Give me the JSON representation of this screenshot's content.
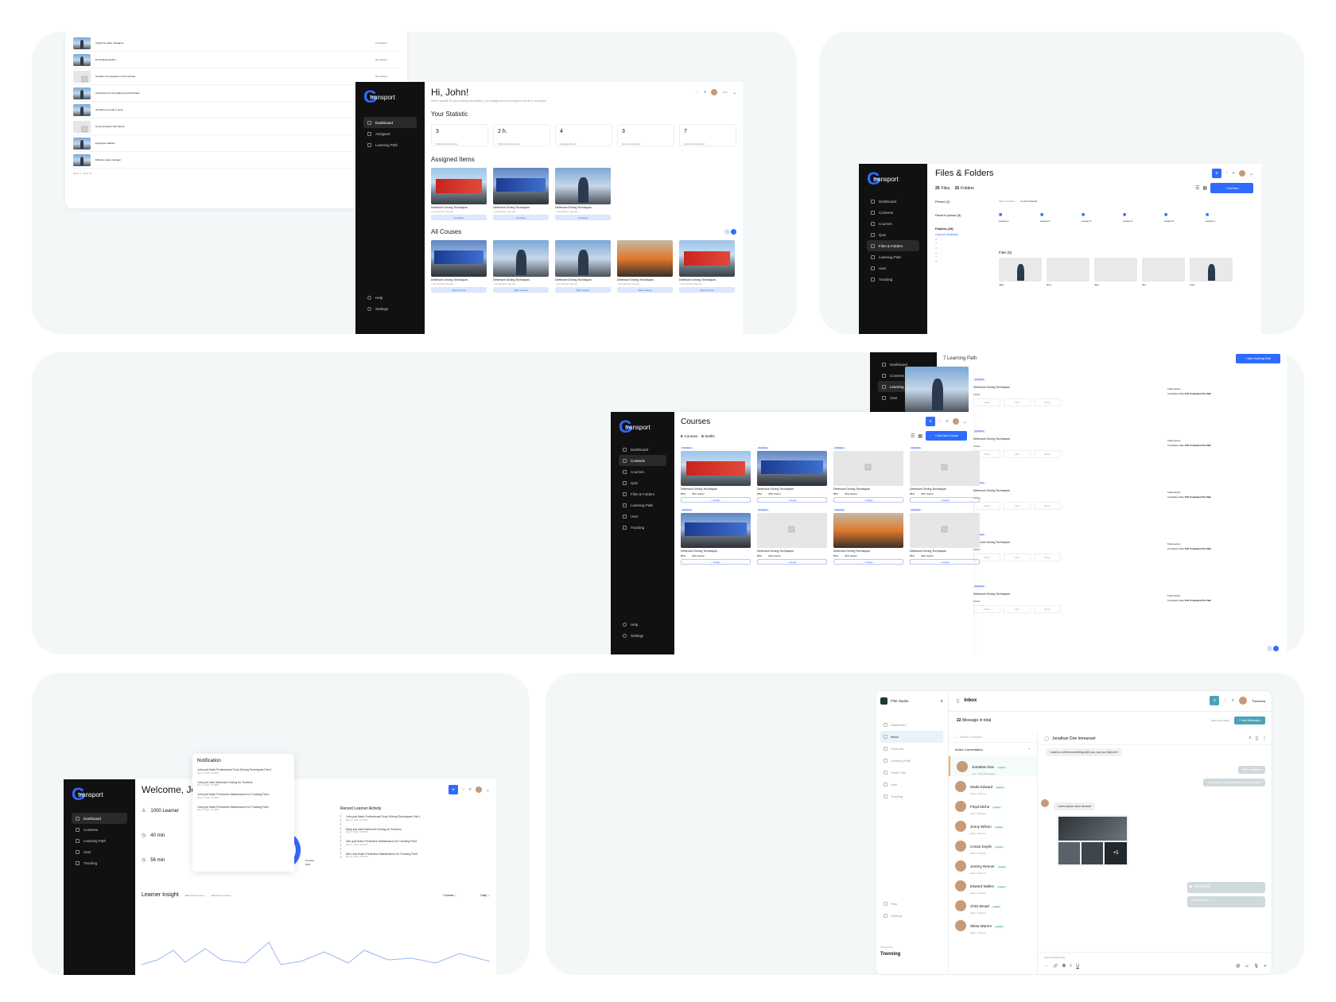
{
  "panel1": {
    "list_rows": [
      {
        "title": "Impact for sales managers",
        "status": "Completed"
      },
      {
        "title": "Dominating leaders",
        "status": "Not started"
      },
      {
        "title": "Creation of a signature in the contract",
        "status": "Not started"
      },
      {
        "title": "Instructions for the platforms administrator",
        "status": "Completed"
      },
      {
        "title": "IP platforms youth in work",
        "status": "Not started"
      },
      {
        "title": "Communication with clients",
        "status": "Not started"
      },
      {
        "title": "Employee platform",
        "status": "Completed"
      },
      {
        "title": "Effective sales manager",
        "status": "Completed"
      }
    ],
    "pager": "Show 1 - 10 in 16",
    "sidebar": {
      "brand": "transport",
      "items": [
        "Dashboard",
        "Assigned",
        "Learning Path"
      ],
      "bottom": [
        "Help",
        "Settings"
      ]
    },
    "greeting": "Hi, John!",
    "greeting_sub": "Here's update for your training information, your assignment and progress are all in one place",
    "stat_title": "Your Statistic",
    "stats": [
      {
        "value": "3",
        "label": "Total Learning items"
      },
      {
        "value": "2 h.",
        "label": "Total Learning items"
      },
      {
        "value": "4",
        "label": "Average Result"
      },
      {
        "value": "3",
        "label": "Items Completed"
      },
      {
        "value": "7",
        "label": "Quizzes Completed"
      }
    ],
    "assigned_title": "Assigned Items",
    "assigned": [
      {
        "title": "Defensive Driving Techniques",
        "meta": "• Last watched 1 day ago",
        "button": "Continue"
      },
      {
        "title": "Defensive Driving Techniques",
        "meta": "• Last watched 1 day ago",
        "button": "Continue"
      },
      {
        "title": "Defensive Driving Techniques",
        "meta": "• Last watched 1 day ago",
        "button": "Continue"
      }
    ],
    "all_title": "All Couses",
    "all": [
      {
        "title": "Defensive Driving Techniques",
        "meta": "• Last watched 1 day ago",
        "button": "Start Course"
      },
      {
        "title": "Defensive Driving Techniques",
        "meta": "• Last watched 1 day ago",
        "button": "Start Course"
      },
      {
        "title": "Defensive Driving Techniques",
        "meta": "• Last watched 1 day ago",
        "button": "Start Course"
      },
      {
        "title": "Defensive Driving Techniques",
        "meta": "• Last watched 1 day ago",
        "button": "Start Course"
      },
      {
        "title": "Defensive Driving Techniques",
        "meta": "• Last watched 1 day ago",
        "button": "Start Course"
      }
    ],
    "user": "John"
  },
  "panel2": {
    "sidebar": {
      "brand": "transport",
      "items": [
        "Dashboard",
        "Contents",
        "Courses",
        "Quiz",
        "Files & Folders",
        "Learning Path",
        "User",
        "Tracking"
      ]
    },
    "title": "Files & Folders",
    "files_count": "20",
    "files_label": "Files,",
    "folders_count": "15",
    "folders_label": "Folders",
    "add_button": "+ Add New",
    "pinned": "Pinned (2)",
    "recent": "Recent Upload (8)",
    "folders_title": "Folders (15)",
    "course_material": "Course material",
    "breadcrumb_a": "Files & Folders",
    "breadcrumb_b": "Course Material",
    "lessons": [
      "Lesson 1",
      "Lesson 2",
      "Lesson 3",
      "Lesson 4",
      "Lesson 5",
      "Lesson 1"
    ],
    "files_section": "Files (5)",
    "files": [
      "Jayk",
      "shot",
      "Jaut",
      "doc",
      "xnyk"
    ]
  },
  "panel3": {
    "sidebar": {
      "brand": "transport",
      "items": [
        "Dashboard",
        "Contents",
        "Courses",
        "Quiz",
        "Files & Folders",
        "Learning Path",
        "User",
        "Tracking"
      ],
      "bottom": [
        "Help",
        "Settings"
      ]
    },
    "title": "Courses",
    "courses_count": "6",
    "courses_label": "Courses",
    "drafts_count": "6",
    "drafts_label": "Drafts",
    "add_button": "+ Add New Course",
    "card_title": "Defensive Driving Techniques",
    "status_published": "Published",
    "assign": "+ Assign",
    "completion": "85%",
    "useful": "45% Useful",
    "lp_sidebar": [
      "Dashboard",
      "Contents",
      "Learning Path",
      "User"
    ],
    "lp_title": "7 Learning Path",
    "lp_add": "+ Add Learning Path",
    "lp_item_title": "Defensive Driving Techniques",
    "lp_content": "Content",
    "lp_steps": [
      "Course",
      "Quiz",
      "Survey"
    ],
    "lp_total": "Total Learner",
    "lp_rate": "Completion Rate",
    "lp_rate_val": "72% Completed this Path"
  },
  "panel4": {
    "sidebar": {
      "brand": "transport",
      "items": [
        "Dashboard",
        "Contents",
        "Learning Path",
        "User",
        "Tracking"
      ]
    },
    "greeting": "Welcome, Jo",
    "notif_title": "Notification",
    "notifs": [
      {
        "text": "John just finish Professional Truck Driving Techniques Part 1",
        "date": "May 17, 2023 - 00:00PM"
      },
      {
        "text": "John just start Defensive Driving for Truckers",
        "date": "May 17, 2023 - 00:00PM"
      },
      {
        "text": "John just finish Preventive Maintenance for Trucking Fleet",
        "date": "May 17, 2023 - 00:00PM"
      },
      {
        "text": "John just finish Preventive Maintenance for Trucking Fleet",
        "date": "May 17, 2023 - 00:00PM"
      }
    ],
    "stat_learner": "1000 Learner",
    "stat_time1": "40 min",
    "stat_time2": "56 min",
    "legend_courses": "Courses",
    "legend_quiz": "Quiz",
    "recent_title": "Recent Learner Activity",
    "recent": [
      {
        "text": "John just finish Professional Truck Driving Techniques Part 1",
        "date": "May 17, 2023 - 00:00PM"
      },
      {
        "text": "Mary just start Defensive Driving for Truckers",
        "date": "May 17, 2023 - 00:00PM"
      },
      {
        "text": "Alex just finish Preventive Maintenance for Trucking Fleet",
        "date": "May 17, 2023 - 00:00PM"
      },
      {
        "text": "Alex Just finish Preventive Maintenance for Trucking Fleet",
        "date": "May 17, 2023 - 00:00PM"
      }
    ],
    "insight_title": "Learner Insight",
    "active_learner_a": "244",
    "active_learner_b": "244",
    "active_label": "Active Learner",
    "filter_courses": "Courses",
    "filter_daily": "Daily"
  },
  "panel5": {
    "workspace": "Flint Studio",
    "title": "Inbox",
    "total_count": "22",
    "total_label": "Message in total",
    "mark_read": "Mark all as Read",
    "new_button": "+ New Messages",
    "search_placeholder": "Search messages",
    "active_conv": "Active Convertation",
    "user": "Theresha",
    "nav": [
      "Dashboard",
      "Inbox",
      "Contents",
      "Learning Path",
      "Public Site",
      "User",
      "Tracking",
      "Help",
      "Settings"
    ],
    "powered": "Powered by",
    "powered_brand": "Trenning",
    "contacts": [
      {
        "name": "Jonathan Doe",
        "sub": "You : Voice Messages"
      },
      {
        "name": "Wade Edward",
        "sub": "Hello, Theresa"
      },
      {
        "name": "Floyd Miche",
        "sub": "Hello, Theresa"
      },
      {
        "name": "Jenny Wilson",
        "sub": "Hello, Theresa"
      },
      {
        "name": "Conan Doyile",
        "sub": "Hello, Theresa"
      },
      {
        "name": "Jeremy Renner",
        "sub": "Hello, Theresa"
      },
      {
        "name": "Edward Wallen",
        "sub": "Hello, Theresa"
      },
      {
        "name": "Chris Broad",
        "sub": "Hello, Theresa"
      },
      {
        "name": "Nikita Warren",
        "sub": "Hello, Theresa"
      }
    ],
    "learner_badge": "Learner",
    "chat_name": "Jonathan Doe Immanuel",
    "msg1": "I want to confirm something with you, can you help me?",
    "msg2": "Hello, Jonathan",
    "msg3": "Yes why not, what problem are you having?",
    "msg4": "Lorem ipsum dolor sit amet",
    "more_photos": "+5",
    "doc_label": "Document.pdf",
    "composer_placeholder": "Type message here"
  },
  "colors": {
    "accent": "#2f6bff",
    "sidebar": "#111111",
    "panel": "#f3f7f8",
    "inbox_accent": "#4aa3b8"
  }
}
